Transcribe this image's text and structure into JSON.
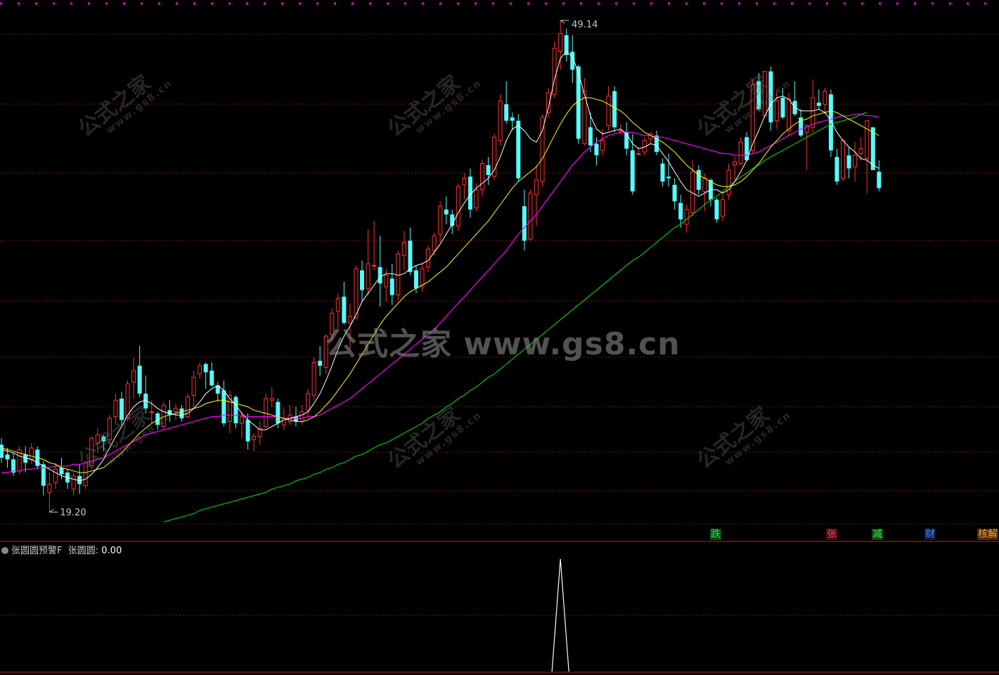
{
  "chart_data": {
    "type": "candlestick",
    "y_range": [
      17.5,
      50.0
    ],
    "high_label": "49.14",
    "low_label": "19.20",
    "ohlc": [
      [
        23.3,
        23.7,
        22.2,
        22.5
      ],
      [
        22.7,
        23.1,
        21.9,
        22.4
      ],
      [
        22.4,
        22.8,
        21.4,
        21.6
      ],
      [
        21.7,
        23.2,
        21.5,
        23.0
      ],
      [
        22.7,
        23.2,
        21.6,
        22.2
      ],
      [
        22.4,
        23.4,
        22.1,
        23.1
      ],
      [
        23.0,
        23.2,
        21.8,
        22.0
      ],
      [
        22.1,
        22.3,
        20.2,
        20.8
      ],
      [
        20.4,
        21.6,
        19.2,
        20.9
      ],
      [
        21.0,
        22.2,
        20.6,
        21.8
      ],
      [
        21.9,
        22.5,
        21.2,
        21.5
      ],
      [
        21.6,
        21.8,
        20.6,
        21.0
      ],
      [
        20.6,
        21.6,
        20.2,
        21.4
      ],
      [
        21.4,
        22.1,
        20.3,
        20.9
      ],
      [
        20.8,
        22.3,
        20.6,
        22.2
      ],
      [
        22.0,
        23.8,
        21.8,
        23.7
      ],
      [
        23.4,
        24.3,
        22.8,
        23.9
      ],
      [
        23.8,
        23.9,
        22.9,
        23.5
      ],
      [
        23.6,
        25.1,
        23.3,
        24.9
      ],
      [
        25.0,
        26.4,
        24.6,
        26.0
      ],
      [
        26.1,
        26.5,
        24.5,
        24.8
      ],
      [
        24.9,
        27.2,
        24.7,
        27.0
      ],
      [
        27.1,
        28.6,
        26.1,
        27.8
      ],
      [
        28.1,
        29.3,
        26.2,
        26.4
      ],
      [
        26.4,
        27.5,
        25.2,
        25.5
      ],
      [
        25.3,
        26.0,
        24.6,
        25.3
      ],
      [
        25.2,
        25.3,
        24.2,
        24.5
      ],
      [
        24.4,
        25.9,
        24.2,
        25.7
      ],
      [
        25.4,
        26.0,
        24.7,
        25.1
      ],
      [
        25.3,
        25.8,
        24.8,
        25.5
      ],
      [
        25.5,
        25.7,
        24.7,
        24.9
      ],
      [
        25.0,
        26.4,
        24.9,
        26.2
      ],
      [
        26.3,
        27.8,
        25.6,
        27.4
      ],
      [
        27.6,
        28.3,
        27.3,
        28.1
      ],
      [
        28.2,
        28.3,
        26.7,
        27.7
      ],
      [
        27.8,
        28.3,
        26.8,
        26.9
      ],
      [
        26.9,
        27.1,
        25.9,
        26.4
      ],
      [
        26.6,
        27.2,
        24.4,
        24.6
      ],
      [
        24.7,
        26.6,
        24.0,
        26.3
      ],
      [
        26.2,
        26.3,
        24.3,
        24.6
      ],
      [
        24.6,
        25.3,
        23.7,
        25.0
      ],
      [
        24.8,
        25.2,
        23.0,
        23.5
      ],
      [
        23.6,
        24.0,
        22.9,
        23.8
      ],
      [
        23.8,
        24.7,
        23.3,
        24.3
      ],
      [
        24.4,
        26.4,
        24.3,
        26.1
      ],
      [
        26.0,
        26.8,
        25.6,
        26.1
      ],
      [
        25.9,
        26.1,
        24.3,
        24.6
      ],
      [
        24.5,
        25.5,
        24.2,
        24.9
      ],
      [
        24.7,
        25.7,
        24.5,
        25.1
      ],
      [
        25.0,
        25.6,
        24.4,
        24.7
      ],
      [
        24.7,
        25.7,
        24.5,
        25.3
      ],
      [
        25.4,
        26.7,
        24.9,
        26.4
      ],
      [
        26.3,
        28.6,
        26.0,
        28.3
      ],
      [
        28.4,
        29.3,
        27.5,
        28.1
      ],
      [
        28.0,
        30.0,
        27.6,
        29.9
      ],
      [
        30.0,
        31.6,
        29.6,
        31.3
      ],
      [
        31.4,
        32.5,
        30.1,
        32.2
      ],
      [
        32.3,
        33.2,
        30.6,
        30.7
      ],
      [
        30.7,
        31.9,
        29.1,
        31.1
      ],
      [
        31.0,
        34.2,
        30.9,
        34.0
      ],
      [
        33.9,
        34.5,
        32.0,
        32.7
      ],
      [
        32.8,
        36.4,
        32.4,
        34.3
      ],
      [
        34.2,
        36.9,
        33.9,
        34.2
      ],
      [
        34.1,
        36.0,
        31.7,
        33.1
      ],
      [
        32.9,
        34.0,
        32.0,
        33.6
      ],
      [
        33.4,
        34.3,
        31.8,
        32.4
      ],
      [
        32.4,
        35.1,
        32.1,
        34.9
      ],
      [
        34.8,
        36.3,
        33.9,
        35.6
      ],
      [
        35.7,
        36.5,
        33.6,
        33.8
      ],
      [
        33.9,
        34.2,
        32.5,
        32.8
      ],
      [
        32.9,
        34.3,
        32.6,
        34.0
      ],
      [
        34.1,
        35.4,
        33.8,
        35.2
      ],
      [
        35.1,
        36.2,
        34.8,
        36.0
      ],
      [
        36.1,
        38.1,
        35.6,
        37.8
      ],
      [
        37.6,
        38.4,
        36.7,
        37.3
      ],
      [
        37.3,
        37.6,
        36.1,
        36.6
      ],
      [
        36.6,
        39.2,
        36.3,
        39.0
      ],
      [
        39.1,
        39.8,
        38.2,
        39.5
      ],
      [
        39.6,
        40.1,
        37.1,
        37.6
      ],
      [
        37.7,
        39.2,
        37.5,
        38.8
      ],
      [
        38.8,
        40.6,
        38.4,
        40.4
      ],
      [
        40.3,
        40.8,
        39.1,
        39.7
      ],
      [
        39.6,
        42.2,
        39.4,
        42.0
      ],
      [
        41.8,
        44.6,
        41.5,
        44.2
      ],
      [
        44.0,
        45.4,
        42.8,
        43.0
      ],
      [
        43.2,
        43.5,
        42.4,
        43.0
      ],
      [
        43.0,
        43.4,
        39.3,
        39.5
      ],
      [
        37.8,
        38.8,
        35.1,
        35.7
      ],
      [
        35.8,
        38.8,
        35.7,
        38.6
      ],
      [
        38.5,
        40.3,
        36.6,
        39.4
      ],
      [
        39.3,
        43.4,
        39.0,
        43.2
      ],
      [
        43.5,
        45.0,
        43.2,
        44.7
      ],
      [
        44.6,
        47.8,
        44.4,
        47.4
      ],
      [
        47.2,
        49.1,
        46.1,
        48.3
      ],
      [
        48.2,
        48.6,
        46.6,
        47.0
      ],
      [
        47.2,
        48.2,
        45.3,
        46.1
      ],
      [
        46.3,
        46.4,
        41.6,
        41.9
      ],
      [
        41.6,
        45.6,
        41.5,
        44.8
      ],
      [
        42.6,
        43.5,
        41.1,
        41.5
      ],
      [
        41.6,
        42.0,
        40.3,
        40.9
      ],
      [
        41.2,
        42.5,
        40.9,
        41.8
      ],
      [
        42.7,
        45.1,
        42.4,
        44.5
      ],
      [
        44.8,
        45.1,
        42.3,
        42.6
      ],
      [
        42.4,
        42.8,
        42.2,
        42.4
      ],
      [
        42.3,
        42.9,
        40.9,
        41.3
      ],
      [
        41.2,
        42.2,
        38.5,
        38.7
      ],
      [
        41.0,
        41.4,
        40.9,
        41.0
      ],
      [
        41.1,
        42.0,
        40.9,
        41.8
      ],
      [
        41.9,
        42.3,
        41.6,
        42.2
      ],
      [
        42.1,
        42.4,
        40.9,
        41.1
      ],
      [
        40.4,
        40.7,
        39.0,
        39.3
      ],
      [
        39.6,
        41.0,
        39.0,
        39.5
      ],
      [
        39.1,
        39.5,
        37.6,
        38.1
      ],
      [
        38.0,
        38.5,
        36.5,
        37.0
      ],
      [
        36.7,
        37.9,
        36.2,
        37.6
      ],
      [
        37.4,
        40.6,
        37.2,
        39.9
      ],
      [
        40.0,
        40.3,
        38.5,
        38.8
      ],
      [
        38.7,
        39.8,
        37.5,
        39.5
      ],
      [
        39.4,
        39.5,
        37.8,
        38.2
      ],
      [
        38.2,
        38.3,
        36.8,
        37.0
      ],
      [
        37.2,
        38.7,
        36.9,
        38.2
      ],
      [
        38.5,
        40.4,
        38.2,
        40.0
      ],
      [
        40.3,
        40.8,
        39.4,
        40.5
      ],
      [
        40.4,
        42.0,
        40.3,
        41.7
      ],
      [
        42.0,
        42.3,
        40.5,
        40.6
      ],
      [
        41.2,
        45.5,
        41.0,
        45.2
      ],
      [
        45.4,
        45.9,
        43.6,
        43.7
      ],
      [
        43.3,
        46.0,
        43.2,
        46.0
      ],
      [
        46.0,
        46.3,
        42.4,
        42.9
      ],
      [
        43.0,
        44.9,
        42.5,
        44.2
      ],
      [
        44.4,
        45.0,
        43.1,
        43.2
      ],
      [
        42.4,
        44.7,
        42.1,
        44.3
      ],
      [
        44.2,
        45.4,
        43.3,
        43.4
      ],
      [
        43.2,
        43.7,
        42.0,
        42.1
      ],
      [
        42.3,
        42.8,
        40.0,
        42.7
      ],
      [
        42.6,
        45.5,
        42.3,
        44.4
      ],
      [
        44.1,
        44.9,
        43.7,
        43.9
      ],
      [
        44.0,
        45.0,
        43.4,
        44.8
      ],
      [
        44.6,
        44.9,
        40.8,
        41.2
      ],
      [
        40.8,
        41.3,
        39.1,
        39.3
      ],
      [
        39.5,
        41.9,
        39.3,
        41.8
      ],
      [
        40.9,
        41.4,
        39.5,
        40.1
      ],
      [
        40.2,
        41.7,
        39.3,
        40.9
      ],
      [
        41.0,
        42.0,
        40.6,
        41.3
      ],
      [
        40.7,
        43.0,
        38.6,
        43.0
      ],
      [
        42.6,
        42.6,
        40.0,
        40.0
      ],
      [
        39.9,
        40.6,
        38.7,
        38.9
      ]
    ],
    "ma_white": [
      23.0,
      22.9,
      22.8,
      22.6,
      22.5,
      22.4,
      22.2,
      22.0,
      21.8,
      21.6,
      21.4,
      21.3,
      21.2,
      21.1,
      21.2,
      21.5,
      21.9,
      22.4,
      23.1,
      23.8,
      24.4,
      25.1,
      25.6,
      25.9,
      26.0,
      25.8,
      25.5,
      25.3,
      25.2,
      25.1,
      25.1,
      25.2,
      25.5,
      25.9,
      26.4,
      26.7,
      26.9,
      26.6,
      26.1,
      25.7,
      25.2,
      24.8,
      24.5,
      24.2,
      24.2,
      24.4,
      24.6,
      24.8,
      24.9,
      25.0,
      25.1,
      25.3,
      25.8,
      26.4,
      27.2,
      28.1,
      29.1,
      29.9,
      30.5,
      31.2,
      32.0,
      32.5,
      33.0,
      33.5,
      33.7,
      33.7,
      33.6,
      33.7,
      34.0,
      34.2,
      34.3,
      34.5,
      35.0,
      35.5,
      36.1,
      36.7,
      37.4,
      38.0,
      38.5,
      38.9,
      39.2,
      39.5,
      40.0,
      40.8,
      41.8,
      42.5,
      42.7,
      42.4,
      41.9,
      41.7,
      42.4,
      43.8,
      45.5,
      46.8,
      47.2,
      46.9,
      45.9,
      44.6,
      43.3,
      42.5,
      42.2,
      42.3,
      42.4,
      42.5,
      42.2,
      41.6,
      41.3,
      41.4,
      41.6,
      41.5,
      41.0,
      40.5,
      39.9,
      39.3,
      38.8,
      38.6,
      38.4,
      38.6,
      38.8,
      38.8,
      38.6,
      38.8,
      39.3,
      39.9,
      40.6,
      41.6,
      42.4,
      43.3,
      44.0,
      44.4,
      44.5,
      44.3,
      43.8,
      43.6,
      43.6,
      43.6,
      43.7,
      43.5,
      43.0,
      42.3,
      41.8,
      41.4,
      41.1,
      40.7,
      40.6,
      40.3,
      40.1
    ],
    "ma_yellow": [
      23.1,
      23.0,
      22.9,
      22.8,
      22.7,
      22.6,
      22.5,
      22.4,
      22.2,
      22.1,
      21.9,
      21.8,
      21.7,
      21.6,
      21.6,
      21.7,
      21.8,
      21.9,
      22.2,
      22.5,
      22.8,
      23.2,
      23.6,
      24.0,
      24.3,
      24.6,
      24.8,
      25.0,
      25.1,
      25.2,
      25.3,
      25.4,
      25.5,
      25.6,
      25.8,
      25.9,
      26.0,
      26.0,
      25.9,
      25.8,
      25.7,
      25.6,
      25.4,
      25.3,
      25.2,
      25.1,
      25.0,
      24.9,
      24.8,
      24.7,
      24.7,
      24.8,
      25.0,
      25.3,
      25.7,
      26.1,
      26.6,
      27.1,
      27.6,
      28.2,
      28.8,
      29.4,
      30.0,
      30.6,
      31.1,
      31.5,
      31.9,
      32.3,
      32.6,
      32.8,
      33.0,
      33.2,
      33.5,
      33.8,
      34.1,
      34.5,
      34.9,
      35.3,
      35.7,
      36.1,
      36.5,
      36.9,
      37.4,
      37.9,
      38.4,
      38.9,
      39.3,
      39.6,
      39.9,
      40.2,
      40.7,
      41.4,
      42.1,
      42.8,
      43.4,
      43.9,
      44.2,
      44.4,
      44.4,
      44.3,
      44.2,
      44.0,
      43.8,
      43.6,
      43.3,
      42.9,
      42.6,
      42.3,
      42.1,
      41.9,
      41.7,
      41.4,
      41.1,
      40.7,
      40.3,
      40.0,
      39.7,
      39.5,
      39.3,
      39.1,
      39.0,
      39.0,
      39.1,
      39.3,
      39.6,
      40.0,
      40.4,
      40.9,
      41.4,
      41.8,
      42.2,
      42.5,
      42.8,
      43.0,
      43.1,
      43.3,
      43.4,
      43.5,
      43.6,
      43.5,
      43.3,
      43.1,
      42.9,
      42.7,
      42.5,
      42.3,
      42.1
    ],
    "ma_magenta": [
      21.6,
      21.6,
      21.7,
      21.7,
      21.8,
      21.8,
      21.9,
      21.9,
      21.9,
      22.0,
      22.0,
      22.0,
      22.1,
      22.1,
      22.2,
      22.3,
      22.4,
      22.5,
      22.7,
      22.9,
      23.1,
      23.3,
      23.5,
      23.7,
      23.9,
      24.0,
      24.1,
      24.2,
      24.3,
      24.4,
      24.5,
      24.6,
      24.7,
      24.8,
      24.9,
      25.0,
      25.0,
      25.1,
      25.1,
      25.1,
      25.1,
      25.0,
      25.0,
      25.0,
      25.0,
      25.0,
      25.0,
      24.9,
      24.9,
      24.9,
      24.9,
      25.0,
      25.0,
      25.1,
      25.3,
      25.5,
      25.7,
      25.9,
      26.1,
      26.4,
      26.7,
      27.0,
      27.3,
      27.6,
      27.9,
      28.2,
      28.5,
      28.8,
      29.1,
      29.4,
      29.7,
      30.0,
      30.3,
      30.7,
      31.1,
      31.5,
      31.9,
      32.3,
      32.7,
      33.1,
      33.5,
      33.9,
      34.3,
      34.7,
      35.1,
      35.6,
      36.1,
      36.5,
      36.9,
      37.3,
      37.8,
      38.3,
      38.8,
      39.3,
      39.8,
      40.3,
      40.7,
      41.1,
      41.4,
      41.7,
      41.9,
      42.1,
      42.2,
      42.3,
      42.3,
      42.3,
      42.2,
      42.1,
      42.1,
      42.0,
      42.0,
      41.9,
      41.8,
      41.7,
      41.6,
      41.5,
      41.4,
      41.3,
      41.2,
      41.1,
      41.0,
      41.0,
      40.9,
      40.9,
      40.9,
      41.0,
      41.1,
      41.3,
      41.5,
      41.7,
      41.9,
      42.1,
      42.3,
      42.5,
      42.6,
      42.8,
      42.9,
      43.0,
      43.1,
      43.2,
      43.3,
      43.3,
      43.4,
      43.4,
      43.3,
      43.3,
      43.2
    ],
    "ma_green_start": 27,
    "ma_green": [
      18.6,
      18.7,
      18.8,
      18.9,
      19.0,
      19.1,
      19.3,
      19.4,
      19.5,
      19.6,
      19.7,
      19.8,
      19.9,
      20.0,
      20.1,
      20.2,
      20.3,
      20.4,
      20.6,
      20.7,
      20.8,
      20.9,
      21.1,
      21.2,
      21.3,
      21.5,
      21.6,
      21.8,
      21.9,
      22.1,
      22.2,
      22.4,
      22.6,
      22.7,
      22.9,
      23.1,
      23.3,
      23.4,
      23.6,
      23.8,
      24.0,
      24.2,
      24.4,
      24.6,
      24.9,
      25.1,
      25.3,
      25.6,
      25.8,
      26.1,
      26.3,
      26.6,
      26.8,
      27.1,
      27.4,
      27.6,
      27.9,
      28.2,
      28.5,
      28.8,
      29.1,
      29.4,
      29.7,
      30.0,
      30.3,
      30.6,
      30.9,
      31.2,
      31.5,
      31.8,
      32.1,
      32.4,
      32.7,
      33.0,
      33.3,
      33.6,
      33.9,
      34.2,
      34.5,
      34.7,
      35.0,
      35.3,
      35.6,
      35.9,
      36.2,
      36.5,
      36.7,
      37.0,
      37.3,
      37.6,
      37.9,
      38.2,
      38.4,
      38.7,
      39.0,
      39.3,
      39.6,
      39.8,
      40.1,
      40.3,
      40.6,
      40.8,
      41.0,
      41.2,
      41.4,
      41.6,
      41.8,
      42.0,
      42.2,
      42.4,
      42.6,
      42.8,
      42.9,
      43.0,
      43.1,
      43.2,
      43.4,
      43.5
    ],
    "signal_labels": [
      {
        "text": "跌",
        "bg": "#0a4a12",
        "fg": "#2fd84a",
        "x": 1010
      },
      {
        "text": "张",
        "bg": "#4a0a14",
        "fg": "#e84a6a",
        "x": 1175
      },
      {
        "text": "减",
        "bg": "#0a4a12",
        "fg": "#3fe05a",
        "x": 1240
      },
      {
        "text": "财",
        "bg": "#0a1a4a",
        "fg": "#4a90ff",
        "x": 1315
      },
      {
        "text": "核解",
        "bg": "#4a2a0a",
        "fg": "#f0a040",
        "x": 1390
      }
    ],
    "indicator": {
      "name": "张圆圆预警F",
      "series_label": "张圆圆:",
      "value": "0.00",
      "spike_index": 93,
      "spike_value": 1.0
    },
    "colors": {
      "up": "#ff3232",
      "down": "#54fcfc",
      "ma_white": "#ffffff",
      "ma_yellow": "#ffff00",
      "ma_magenta": "#ff00ff",
      "ma_green": "#00c800",
      "grid": "#801010",
      "top_dots": "#ff00ff"
    }
  },
  "watermark": {
    "center": "公式之家 www.gs8.cn",
    "small": "公式之家",
    "small_site": "www.gs8.cn"
  }
}
